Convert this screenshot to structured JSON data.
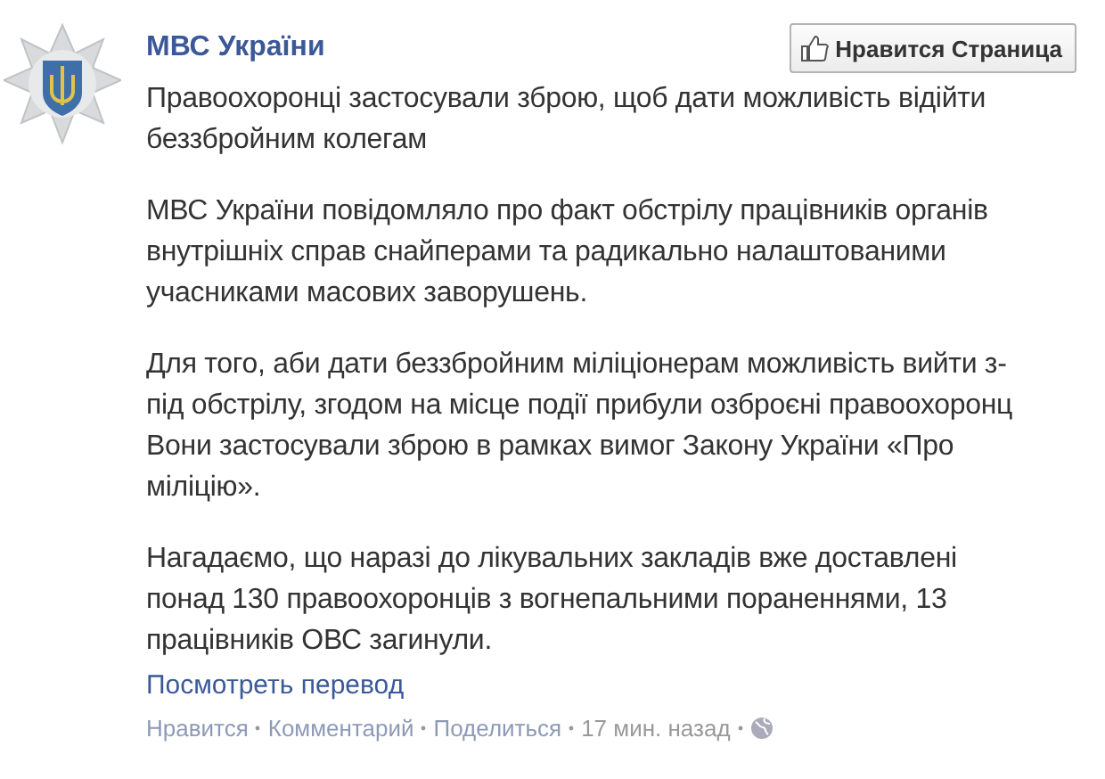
{
  "page": {
    "name": "МВС України",
    "like_button": "Нравится Страница"
  },
  "post": {
    "paragraphs": [
      [
        "Правоохоронці застосували зброю, щоб дати можливість відійти",
        "беззбройним колегам"
      ],
      [
        "МВС України повідомляло про факт обстрілу працівників органів",
        "внутрішніх справ снайперами та радикально налаштованими",
        "учасниками масових заворушень."
      ],
      [
        "Для того, аби дати беззбройним міліціонерам можливість вийти з-",
        "під обстрілу, згодом на місце події прибули озброєні правоохоронц",
        "Вони застосували зброю в рамках вимог Закону України «Про",
        "міліцію»."
      ],
      [
        "Нагадаємо, що наразі до лікувальних закладів вже доставлені",
        "понад 130 правоохоронців з вогнепальними пораненнями, 13",
        "працівників ОВС загинули."
      ]
    ],
    "translate_link": "Посмотреть перевод",
    "footer": [
      {
        "kind": "link",
        "text": "Нравится"
      },
      {
        "kind": "link",
        "text": "Комментарий"
      },
      {
        "kind": "link",
        "text": "Поделиться"
      },
      {
        "kind": "time",
        "text": "17 мин. назад"
      }
    ]
  }
}
